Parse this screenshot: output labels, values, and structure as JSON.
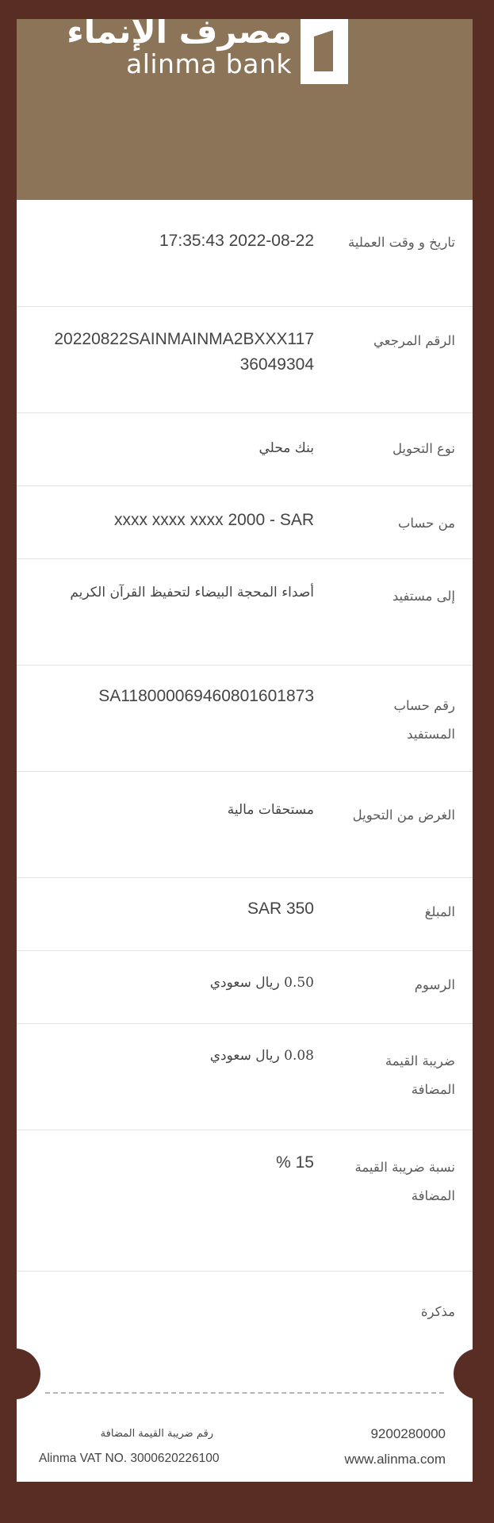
{
  "brand": {
    "name_ar": "مصرف الإنماء",
    "name_en": "alinma bank",
    "colors": {
      "header": "#8c7458",
      "background": "#572d24"
    }
  },
  "details": [
    {
      "label": "تاريخ و وقت العملية",
      "value": "17:35:43 2022-08-22"
    },
    {
      "label": "الرقم المرجعي",
      "value": "20220822SAINMAINMA2BXXX11736049304"
    },
    {
      "label": "نوع التحويل",
      "value": "بنك محلي"
    },
    {
      "label": "من حساب",
      "value": "xxxx xxxx xxxx 2000 - SAR"
    },
    {
      "label": "إلى مستفيد",
      "value": "أصداء المحجة البيضاء لتحفيظ القرآن الكريم"
    },
    {
      "label": "رقم حساب المستفيد",
      "value": "SA118000069460801601873"
    },
    {
      "label": "الغرض من التحويل",
      "value": "مستحقات مالية"
    },
    {
      "label": "المبلغ",
      "value": "SAR 350"
    },
    {
      "label": "الرسوم",
      "value": "0.50 ريال سعودي"
    },
    {
      "label": "ضريبة القيمة المضافة",
      "value": "0.08 ريال سعودي"
    },
    {
      "label": "نسبة ضريبة القيمة المضافة",
      "value": "% 15"
    },
    {
      "label": "مذكرة",
      "value": ""
    }
  ],
  "footer": {
    "phone": "9200280000",
    "website": "www.alinma.com",
    "vat_label_ar": "رقم ضريبة القيمة المضافة",
    "vat_number": "Alinma VAT NO. 3000620226100"
  }
}
